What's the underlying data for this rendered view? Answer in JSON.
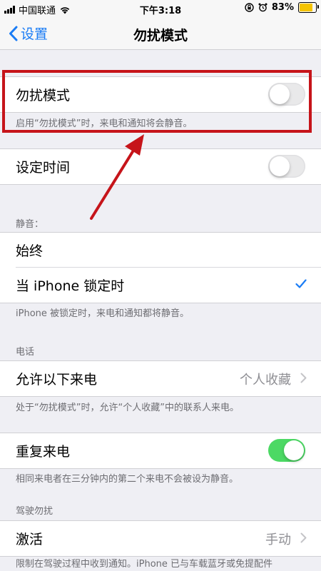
{
  "status_bar": {
    "carrier": "中国联通",
    "time": "下午3:18",
    "battery": "83%",
    "battery_level": 0.83,
    "icons": [
      "signal-bars-icon",
      "wifi-icon",
      "orientation-lock-icon",
      "alarm-icon",
      "battery-icon"
    ]
  },
  "nav": {
    "back_label": "设置",
    "title": "勿扰模式"
  },
  "dnd": {
    "label": "勿扰模式",
    "on": false,
    "note": "启用“勿扰模式”时，来电和通知将会静音。"
  },
  "scheduled": {
    "label": "设定时间",
    "on": false
  },
  "silence": {
    "header": "静音：",
    "always_label": "始终",
    "locked_label": "当 iPhone 锁定时",
    "selected": "当 iPhone 锁定时",
    "note": "iPhone 被锁定时，来电和通知都将静音。"
  },
  "phone": {
    "header": "电话",
    "allow_label": "允许以下来电",
    "allow_value": "个人收藏",
    "allow_note": "处于“勿扰模式”时，允许“个人收藏”中的联系人来电。",
    "repeat_label": "重复来电",
    "repeat_on": true,
    "repeat_note": "相同来电者在三分钟内的第二个来电不会被设为静音。"
  },
  "driving": {
    "header": "驾驶勿扰",
    "activate_label": "激活",
    "activate_value": "手动",
    "note": "限制在驾驶过程中收到通知。iPhone 已与车载蓝牙或免提配件"
  },
  "colors": {
    "accent": "#1a7cf5",
    "toggle_on": "#4cd964",
    "annotation": "#c6141a",
    "battery": "#f5c400"
  }
}
